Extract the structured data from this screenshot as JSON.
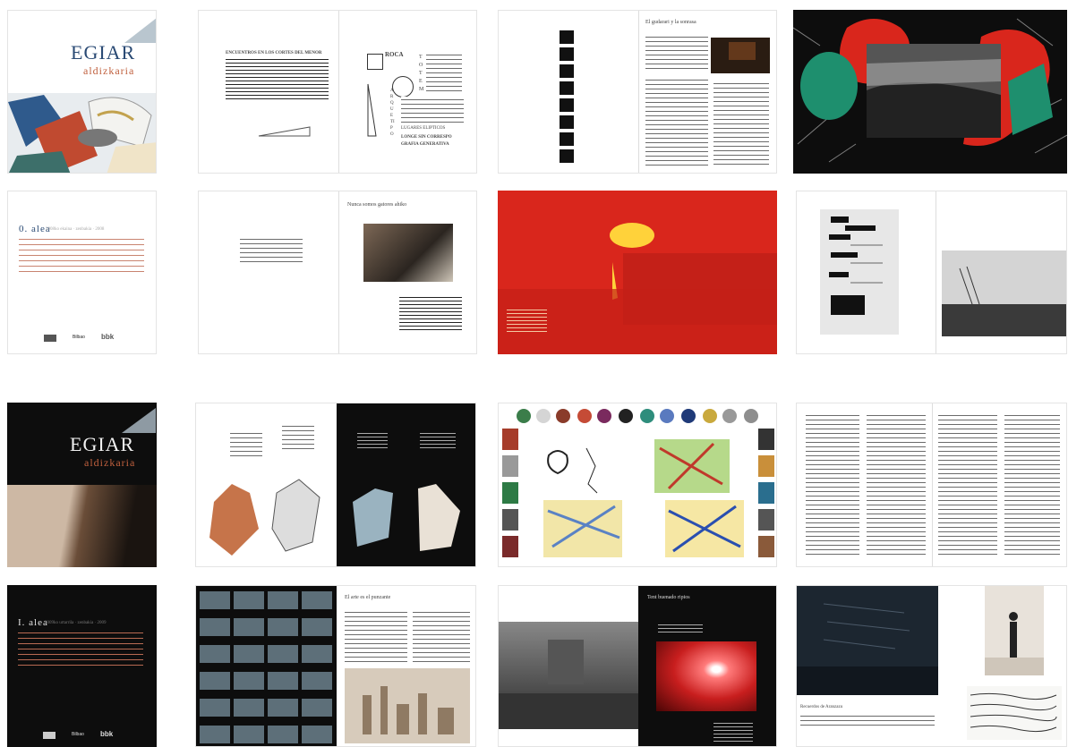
{
  "covers": {
    "issue0": {
      "title": "EGIAR",
      "subtitle": "aldizkaria",
      "issue_heading": "0. alea",
      "issue_meta": "2008ko ekaina · zenbakia · 2008"
    },
    "issue1": {
      "title": "EGIAR",
      "subtitle": "aldizkaria",
      "issue_heading": "I. alea",
      "issue_meta": "2009ko urtarrila · zenbakia · 2009"
    }
  },
  "spreads": {
    "s1": {
      "heading": "ENCUENTROS EN LOS CORTES DEL MENOR",
      "words": [
        "ROCA",
        "TOTEM",
        "ARQUETIPO"
      ],
      "right_lines": [
        "LUGARES ELIPTICOS",
        "LONGE SIN CORRESPO",
        "GRAFIA GENERATIVA"
      ]
    },
    "s2": {
      "title": "El gudarari y la sonrasa"
    },
    "s5": {
      "title": "Nunca somos gatores ahiko"
    },
    "s11": {
      "title": "El arte es el punzante"
    },
    "s14": {
      "title": "Tent buenado ripios"
    },
    "s15": {
      "caption": "Recuerdos de Aranzazu"
    }
  },
  "logos": [
    "Bilbao",
    "bbk"
  ],
  "colors": {
    "accent_red": "#d9261c",
    "cover_blue": "#2a4a74",
    "cover_orange": "#c0603e",
    "dark_bg": "#0d0d0d"
  }
}
